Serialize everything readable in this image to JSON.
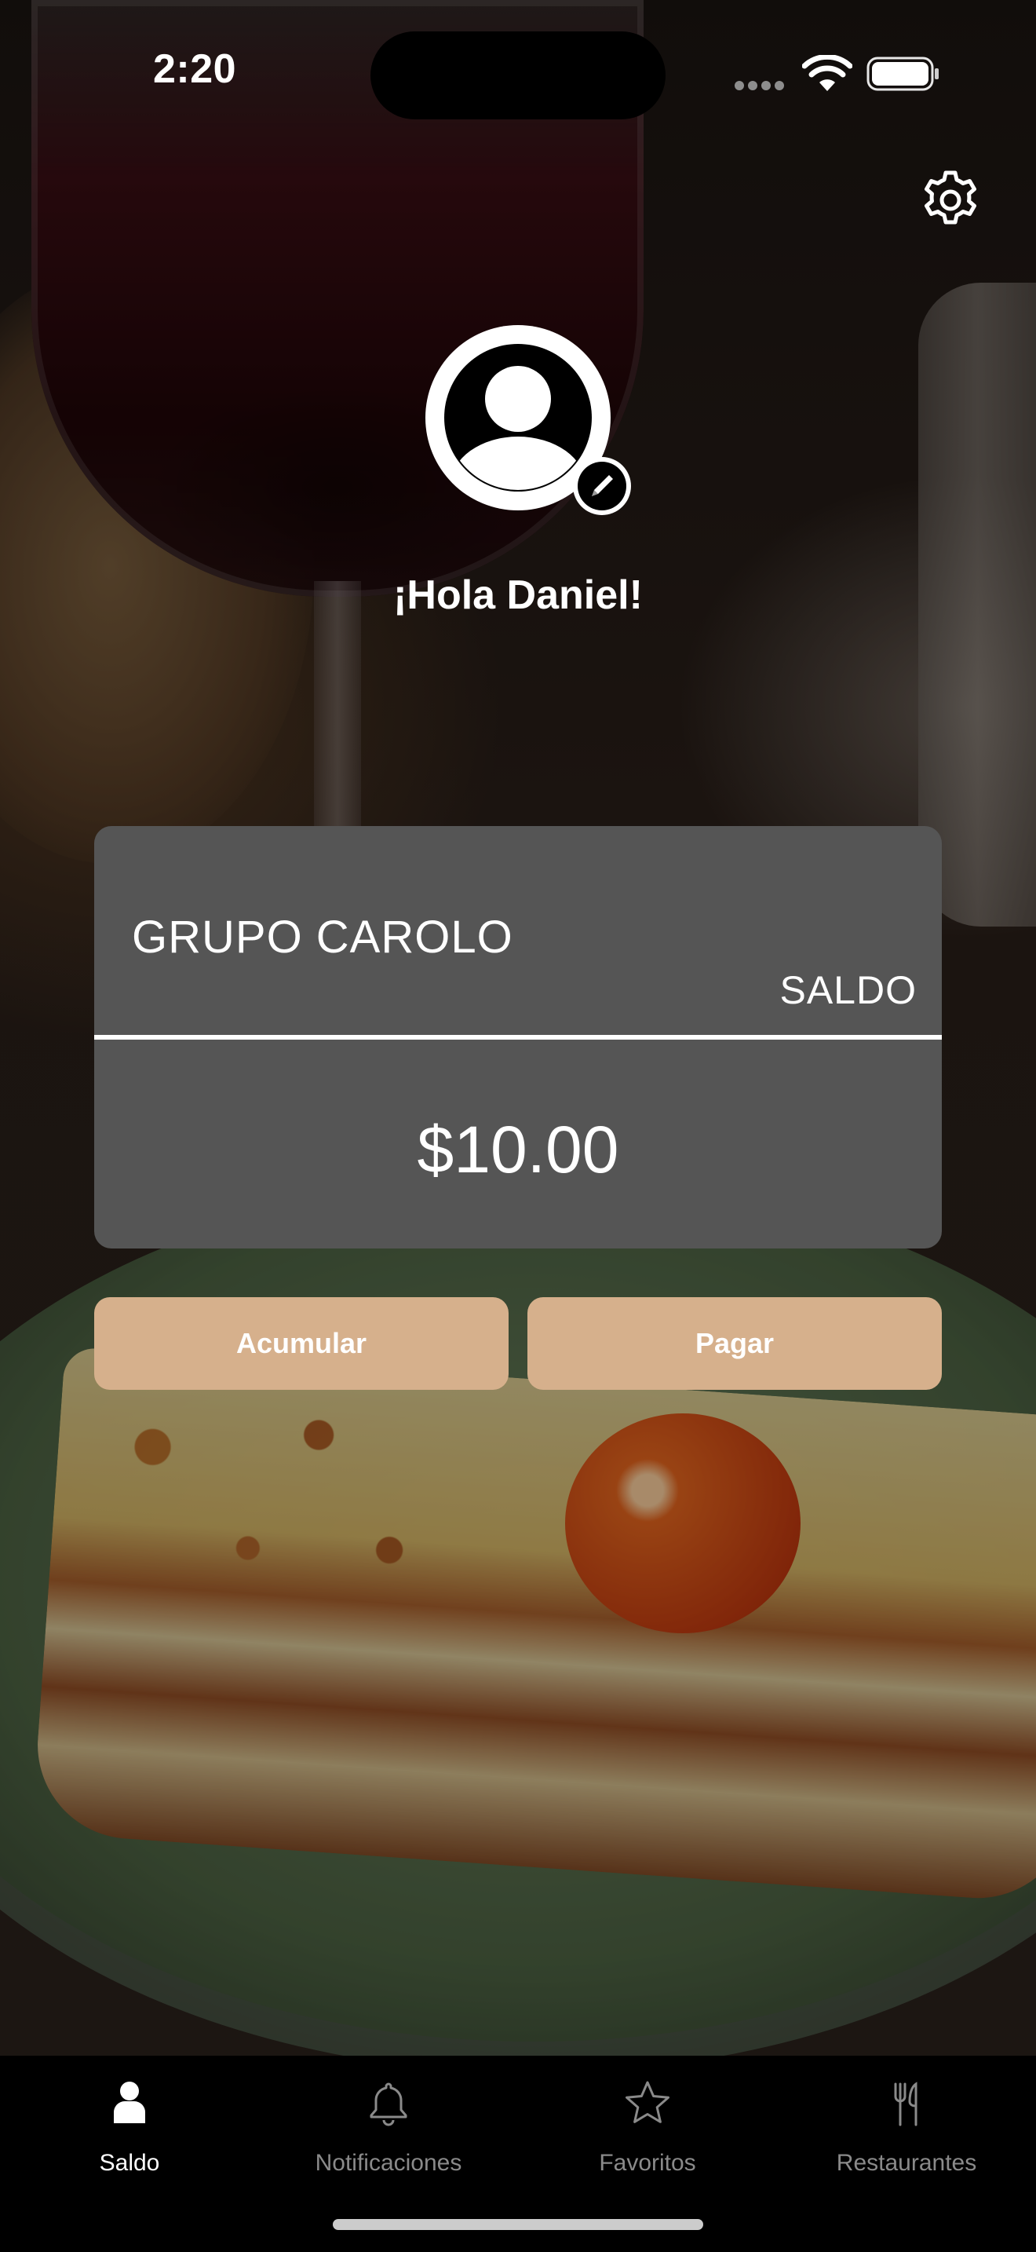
{
  "status_bar": {
    "time": "2:20"
  },
  "header": {
    "greeting": "¡Hola Daniel!"
  },
  "balance_card": {
    "company": "GRUPO CAROLO",
    "label": "SALDO",
    "amount": "$10.00"
  },
  "actions": {
    "accumulate_label": "Acumular",
    "pay_label": "Pagar"
  },
  "tab_bar": {
    "items": [
      {
        "label": "Saldo",
        "icon": "person-icon",
        "active": true
      },
      {
        "label": "Notificaciones",
        "icon": "bell-icon",
        "active": false
      },
      {
        "label": "Favoritos",
        "icon": "star-icon",
        "active": false
      },
      {
        "label": "Restaurantes",
        "icon": "fork-knife-icon",
        "active": false
      }
    ]
  },
  "colors": {
    "card_background": "#555555",
    "button_accent": "#d6b08c",
    "tab_active": "#ffffff",
    "tab_inactive": "#8a8a8a"
  }
}
